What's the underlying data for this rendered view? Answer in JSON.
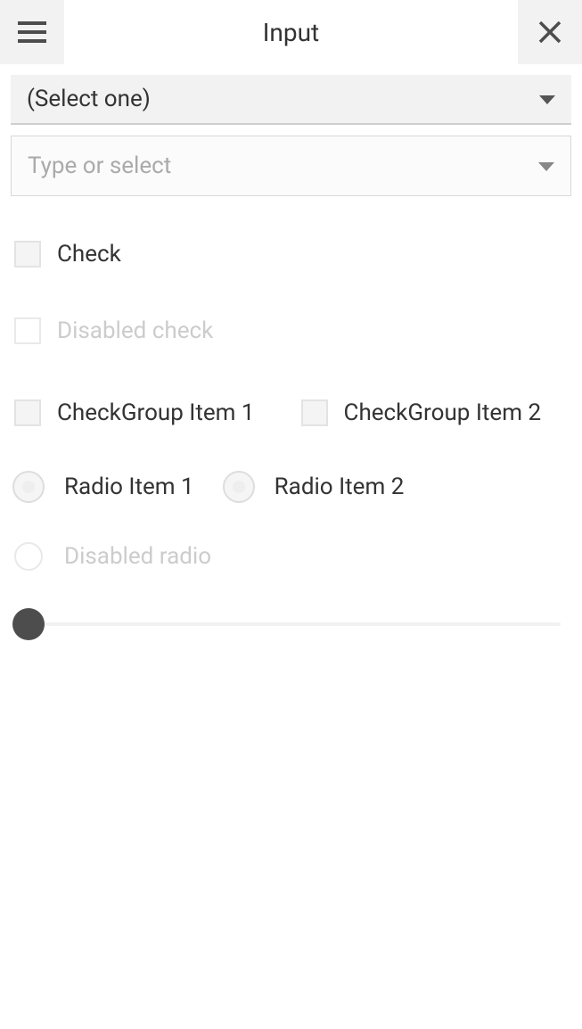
{
  "header": {
    "title": "Input"
  },
  "select": {
    "placeholder": "(Select one)"
  },
  "combo": {
    "placeholder": "Type or select"
  },
  "check": {
    "label": "Check"
  },
  "disabled_check": {
    "label": "Disabled check"
  },
  "check_group": {
    "items": [
      {
        "label": "CheckGroup Item 1"
      },
      {
        "label": "CheckGroup Item 2"
      }
    ]
  },
  "radio_group": {
    "items": [
      {
        "label": "Radio Item 1"
      },
      {
        "label": "Radio Item 2"
      }
    ]
  },
  "disabled_radio": {
    "label": "Disabled radio"
  },
  "slider": {
    "value": 0,
    "min": 0,
    "max": 100
  }
}
